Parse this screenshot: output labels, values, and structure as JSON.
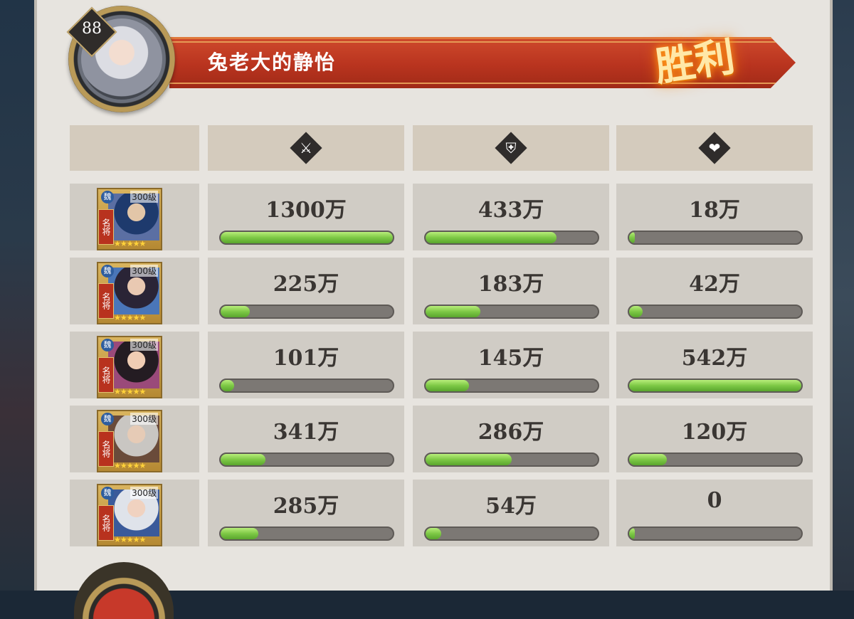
{
  "player": {
    "level": "88",
    "name": "兔老大的静怡",
    "result": "胜利"
  },
  "columns": [
    {
      "icon": "sword-icon",
      "glyph": "⚔"
    },
    {
      "icon": "shield-icon",
      "glyph": "⛨"
    },
    {
      "icon": "heart-icon",
      "glyph": "❤"
    }
  ],
  "heroes": [
    {
      "level": "300级",
      "tag": "名将",
      "badge": "魏",
      "stars": "★★★★★",
      "art": [
        "#1e3a6d",
        "#e2c6a8",
        "#5b6fa3"
      ],
      "damage": "1300万",
      "damage_pct": 1.0,
      "defense": "433万",
      "defense_pct": 0.76,
      "heal": "18万",
      "heal_pct": 0.03
    },
    {
      "level": "300级",
      "tag": "名将",
      "badge": "魏",
      "stars": "★★★★★",
      "art": [
        "#2a2436",
        "#e9c9b2",
        "#4a76b8"
      ],
      "damage": "225万",
      "damage_pct": 0.17,
      "defense": "183万",
      "defense_pct": 0.32,
      "heal": "42万",
      "heal_pct": 0.08
    },
    {
      "level": "300级",
      "tag": "名将",
      "badge": "魏",
      "stars": "★★★★★",
      "art": [
        "#241c22",
        "#f0cdb4",
        "#9a4a7a"
      ],
      "damage": "101万",
      "damage_pct": 0.08,
      "defense": "145万",
      "defense_pct": 0.25,
      "heal": "542万",
      "heal_pct": 1.0
    },
    {
      "level": "300级",
      "tag": "名将",
      "badge": "魏",
      "stars": "★★★★★",
      "art": [
        "#c9c6c2",
        "#e6cbb6",
        "#6a4b3a"
      ],
      "damage": "341万",
      "damage_pct": 0.26,
      "defense": "286万",
      "defense_pct": 0.5,
      "heal": "120万",
      "heal_pct": 0.22
    },
    {
      "level": "300级",
      "tag": "名将",
      "badge": "魏",
      "stars": "★★★★★",
      "art": [
        "#dfe3ea",
        "#f0d2c0",
        "#3a5a9a"
      ],
      "damage": "285万",
      "damage_pct": 0.22,
      "defense": "54万",
      "defense_pct": 0.09,
      "heal": "0",
      "heal_pct": 0.0
    }
  ]
}
